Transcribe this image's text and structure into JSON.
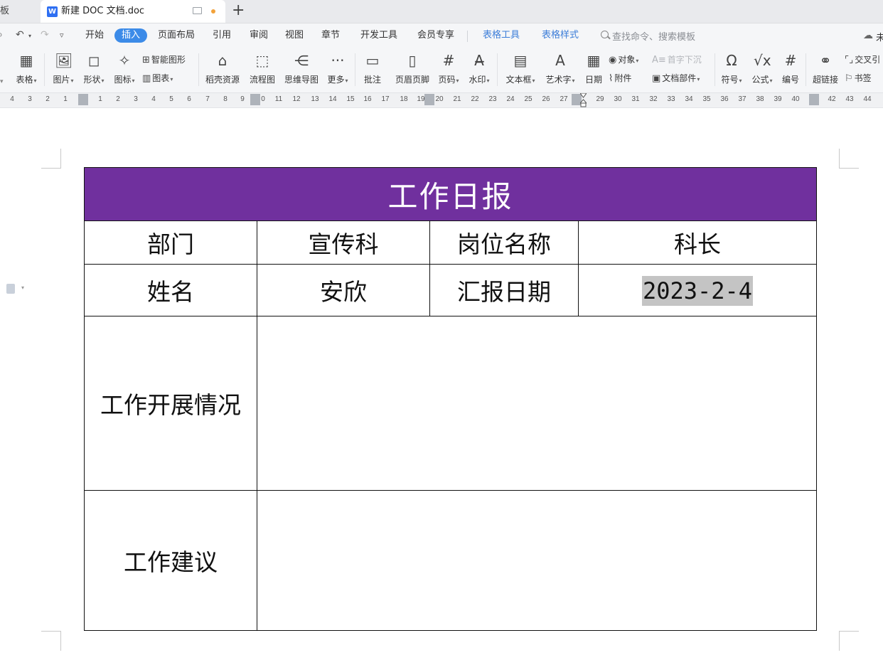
{
  "tabbar": {
    "prev_tab_label": "板",
    "active_tab_title": "新建 DOC 文档.doc",
    "doc_icon_glyph": "W",
    "new_tab_glyph": "+",
    "unsaved_dot_color": "#f2a23a"
  },
  "menubar": {
    "items": [
      "开始",
      "插入",
      "页面布局",
      "引用",
      "审阅",
      "视图",
      "章节",
      "开发工具",
      "会员专享"
    ],
    "active": "插入",
    "context_items": [
      "表格工具",
      "表格样式"
    ],
    "search_placeholder": "查找命令、搜索模板",
    "cloud_label": "未"
  },
  "ribbon": {
    "big_buttons": {
      "table": "表格",
      "picture": "图片",
      "shape": "形状",
      "icon": "图标",
      "docer": "稻壳资源",
      "flowchart": "流程图",
      "mindmap": "思维导图",
      "more": "更多",
      "comment": "批注",
      "header_footer": "页眉页脚",
      "page_number": "页码",
      "watermark": "水印",
      "textbox": "文本框",
      "wordart": "艺术字",
      "date": "日期",
      "symbol": "符号",
      "formula": "公式",
      "numbering": "编号",
      "hyperlink": "超链接"
    },
    "small_buttons": {
      "smart_art": "智能图形",
      "chart": "图表",
      "object": "对象",
      "attachment": "附件",
      "dropcap": "首字下沉",
      "doc_parts": "文档部件",
      "cross_ref": "交叉引",
      "bookmark": "书签"
    }
  },
  "ruler": {
    "ticks": [
      "4",
      "3",
      "2",
      "1",
      "1",
      "2",
      "3",
      "4",
      "5",
      "6",
      "7",
      "8",
      "9",
      "0",
      "11",
      "12",
      "13",
      "14",
      "15",
      "16",
      "17",
      "18",
      "19",
      "20",
      "21",
      "22",
      "23",
      "24",
      "25",
      "26",
      "27",
      "29",
      "30",
      "31",
      "32",
      "33",
      "34",
      "35",
      "36",
      "37",
      "38",
      "39",
      "40",
      "42",
      "43",
      "44"
    ]
  },
  "report": {
    "title": "工作日报",
    "title_bg_color": "#70309e",
    "row1": {
      "dept_label": "部门",
      "dept_value": "宣传科",
      "position_label": "岗位名称",
      "position_value": "科长"
    },
    "row2": {
      "name_label": "姓名",
      "name_value": "安欣",
      "date_label": "汇报日期",
      "date_value": "2023-2-4"
    },
    "row3": {
      "label": "工作开展情况",
      "value": ""
    },
    "row4": {
      "label": "工作建议",
      "value": ""
    }
  }
}
